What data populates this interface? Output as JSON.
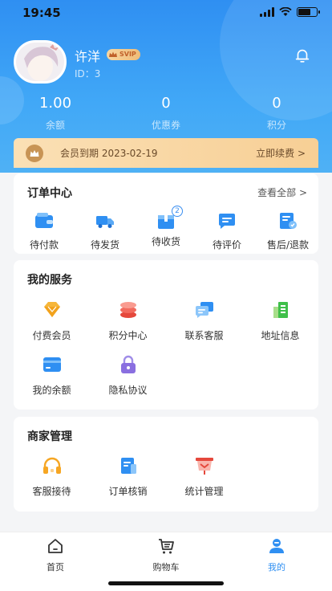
{
  "status_bar": {
    "time": "19:45"
  },
  "profile": {
    "name": "许洋",
    "vip_badge": "SVIP",
    "id_text": "ID：3"
  },
  "stats": [
    {
      "value": "1.00",
      "label": "余额"
    },
    {
      "value": "0",
      "label": "优惠券"
    },
    {
      "value": "0",
      "label": "积分"
    }
  ],
  "membership": {
    "text": "会员到期 2023-02-19",
    "renew_label": "立即续费 >"
  },
  "orders": {
    "title": "订单中心",
    "view_all": "查看全部 >",
    "items": [
      {
        "label": "待付款",
        "icon": "wallet-icon"
      },
      {
        "label": "待发货",
        "icon": "truck-icon"
      },
      {
        "label": "待收货",
        "icon": "package-icon",
        "badge": "2"
      },
      {
        "label": "待评价",
        "icon": "comment-icon"
      },
      {
        "label": "售后/退款",
        "icon": "refund-icon"
      }
    ]
  },
  "services": {
    "title": "我的服务",
    "items": [
      {
        "label": "付费会员",
        "icon": "diamond-icon"
      },
      {
        "label": "积分中心",
        "icon": "coins-icon"
      },
      {
        "label": "联系客服",
        "icon": "chat-icon"
      },
      {
        "label": "地址信息",
        "icon": "building-icon"
      },
      {
        "label": "我的余额",
        "icon": "card-icon"
      },
      {
        "label": "隐私协议",
        "icon": "lock-icon"
      }
    ]
  },
  "merchant": {
    "title": "商家管理",
    "items": [
      {
        "label": "客服接待",
        "icon": "headset-icon"
      },
      {
        "label": "订单核销",
        "icon": "document-icon"
      },
      {
        "label": "统计管理",
        "icon": "chart-board-icon"
      }
    ]
  },
  "tabbar": [
    {
      "label": "首页",
      "icon": "home-icon"
    },
    {
      "label": "购物车",
      "icon": "cart-icon"
    },
    {
      "label": "我的",
      "icon": "user-icon",
      "active": true
    }
  ],
  "colors": {
    "primary": "#2f8ff2",
    "vip_gold": "#f7cf95"
  }
}
